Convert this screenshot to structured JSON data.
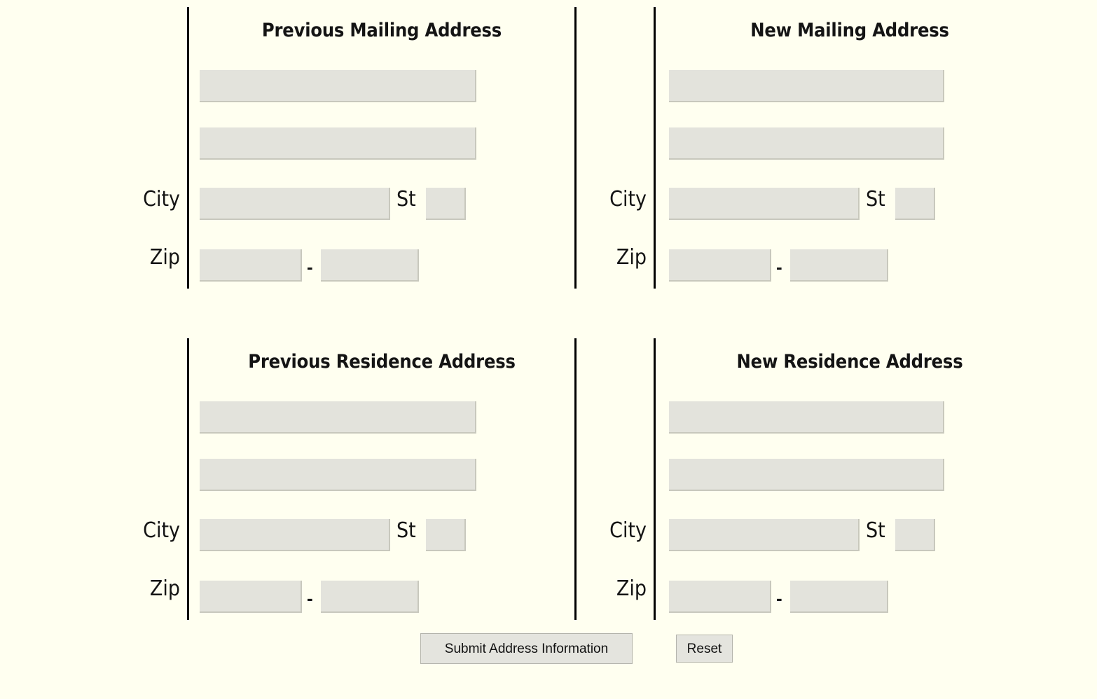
{
  "page": {
    "background_color": "#FFFFF0",
    "field_color": "#E3E3DC",
    "rule_color": "#000000",
    "text_color": "#141414"
  },
  "blocks": [
    {
      "id": "previous-mailing",
      "heading": "Previous Mailing Address",
      "address1_placeholder": "",
      "address1_value": "",
      "address2_placeholder": "",
      "address2_value": "",
      "city_label": "City",
      "city_value": "",
      "state_label": "St",
      "state_value": "",
      "zip_label": "Zip",
      "zip5_value": "",
      "zip_separator": "-",
      "zip4_value": ""
    },
    {
      "id": "new-mailing",
      "heading": "New Mailing Address",
      "address1_placeholder": "",
      "address1_value": "",
      "address2_placeholder": "",
      "address2_value": "",
      "city_label": "City",
      "city_value": "",
      "state_label": "St",
      "state_value": "",
      "zip_label": "Zip",
      "zip5_value": "",
      "zip_separator": "-",
      "zip4_value": ""
    },
    {
      "id": "previous-residence",
      "heading": "Previous Residence Address",
      "address1_placeholder": "",
      "address1_value": "",
      "address2_placeholder": "",
      "address2_value": "",
      "city_label": "City",
      "city_value": "",
      "state_label": "St",
      "state_value": "",
      "zip_label": "Zip",
      "zip5_value": "",
      "zip_separator": "-",
      "zip4_value": ""
    },
    {
      "id": "new-residence",
      "heading": "New Residence Address",
      "address1_placeholder": "",
      "address1_value": "",
      "address2_placeholder": "",
      "address2_value": "",
      "city_label": "City",
      "city_value": "",
      "state_label": "St",
      "state_value": "",
      "zip_label": "Zip",
      "zip5_value": "",
      "zip_separator": "-",
      "zip4_value": ""
    }
  ],
  "actions": {
    "submit_label": "Submit Address Information",
    "reset_label": "Reset"
  }
}
